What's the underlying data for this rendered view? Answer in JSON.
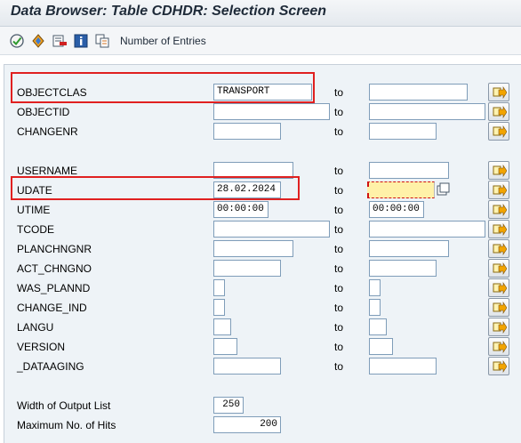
{
  "window": {
    "title": "Data Browser: Table CDHDR: Selection Screen"
  },
  "toolbar": {
    "number_of_entries_label": "Number of Entries",
    "icons": [
      "execute-icon",
      "selection-options-icon",
      "delete-selection-icon",
      "info-icon",
      "copy-icon"
    ]
  },
  "form": {
    "to_label": "to",
    "fields": [
      {
        "name": "OBJECTCLAS",
        "low": "TRANSPORT",
        "high": ""
      },
      {
        "name": "OBJECTID",
        "low": "",
        "high": ""
      },
      {
        "name": "CHANGENR",
        "low": "",
        "high": ""
      },
      {
        "name": "USERNAME",
        "low": "",
        "high": ""
      },
      {
        "name": "UDATE",
        "low": "28.02.2024",
        "high": ""
      },
      {
        "name": "UTIME",
        "low": "00:00:00",
        "high": "00:00:00"
      },
      {
        "name": "TCODE",
        "low": "",
        "high": ""
      },
      {
        "name": "PLANCHNGNR",
        "low": "",
        "high": ""
      },
      {
        "name": "ACT_CHNGNO",
        "low": "",
        "high": ""
      },
      {
        "name": "WAS_PLANND",
        "low": "",
        "high": ""
      },
      {
        "name": "CHANGE_IND",
        "low": "",
        "high": ""
      },
      {
        "name": "LANGU",
        "low": "",
        "high": ""
      },
      {
        "name": "VERSION",
        "low": "",
        "high": ""
      },
      {
        "name": "_DATAAGING",
        "low": "",
        "high": ""
      }
    ],
    "output": {
      "width_label": "Width of Output List",
      "width_value": "250",
      "max_hits_label": "Maximum No. of Hits",
      "max_hits_value": "200"
    }
  },
  "colors": {
    "highlight_box": "#e02020",
    "focus_field": "#fff1a8",
    "background": "#eef3f7"
  }
}
